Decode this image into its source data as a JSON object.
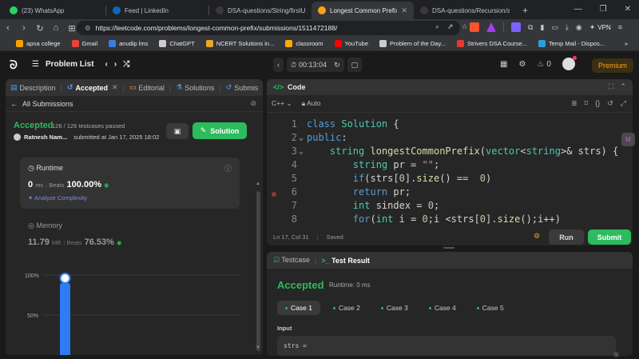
{
  "browser": {
    "tabs": [
      {
        "label": "(23) WhatsApp",
        "icon": "whatsapp-icon",
        "color": "#25d366"
      },
      {
        "label": "Feed | LinkedIn",
        "icon": "linkedin-icon",
        "color": "#0a66c2"
      },
      {
        "label": "DSA-questions/String/firstUniqC",
        "icon": "github-icon",
        "color": "#ffffff"
      },
      {
        "label": "Longest Common Prefix - Le",
        "icon": "leetcode-icon",
        "color": "#ffa116",
        "active": true
      },
      {
        "label": "DSA-questions/Recursion/subse",
        "icon": "github-icon",
        "color": "#ffffff"
      }
    ],
    "new_tab": "+",
    "url": "https://leetcode.com/problems/longest-common-prefix/submissions/1511472188/",
    "vpn_label": "VPN",
    "bookmarks": [
      {
        "label": "apna college",
        "color": "#f4a300"
      },
      {
        "label": "Gmail",
        "color": "#ea4335"
      },
      {
        "label": "anudip lms",
        "color": "#3b7ddd"
      },
      {
        "label": "ChatGPT",
        "color": "#cccccc"
      },
      {
        "label": "NCERT Solutions in...",
        "color": "#e9a72c"
      },
      {
        "label": "classroom",
        "color": "#f9ab00"
      },
      {
        "label": "YouTube",
        "color": "#ff0000"
      },
      {
        "label": "Problem of the Day...",
        "color": "#cccccc"
      },
      {
        "label": "Strivers DSA Course...",
        "color": "#e33b2e"
      },
      {
        "label": "Temp Mail - Dispos...",
        "color": "#2d9fd8"
      }
    ],
    "bookmarks_more": "»"
  },
  "lc": {
    "problem_list": "Problem List",
    "timer": "00:13:04",
    "coins": "0",
    "premium": "Premium"
  },
  "left": {
    "tabs": [
      "Description",
      "Accepted",
      "Editorial",
      "Solutions",
      "Submis"
    ],
    "all_submissions": "All Submissions",
    "status": "Accepted",
    "testcases": "126 / 126 testcases passed",
    "author": "Ratnesh Nam...",
    "submitted": "submitted at Jan 17, 2025 18:02",
    "solution_btn": "Solution",
    "runtime": {
      "title": "Runtime",
      "value": "0",
      "unit": "ms",
      "beats_label": "Beats",
      "beats": "100.00%",
      "analyze": "Analyze Complexity"
    },
    "memory": {
      "title": "Memory",
      "value": "11.79",
      "unit": "MB",
      "beats_label": "Beats",
      "beats": "76.53%"
    }
  },
  "chart_data": {
    "type": "bar",
    "y_ticks": [
      "100%",
      "50%"
    ],
    "ylim": [
      0,
      100
    ],
    "values": [
      100
    ],
    "bar_color": "#2f7bf6"
  },
  "code": {
    "title": "Code",
    "language": "C++",
    "mode": "Auto",
    "lines": [
      {
        "n": "1",
        "fold": "",
        "html": "<span class=\"kw\">class</span> <span class=\"ty\">Solution</span> {"
      },
      {
        "n": "2",
        "fold": "⌄",
        "html": "<span class=\"kw\">public</span>:"
      },
      {
        "n": "3",
        "fold": "⌄",
        "html": "    <span class=\"ty\">string</span> <span class=\"fn\">longestCommonPrefix</span>(<span class=\"ty\">vector</span>&lt;<span class=\"ty\">string</span>&gt;&amp; strs) {"
      },
      {
        "n": "4",
        "fold": "",
        "html": "        <span class=\"ty\">string</span> pr = <span class=\"st\">\"\"</span>;"
      },
      {
        "n": "5",
        "fold": "",
        "html": "        <span class=\"kw\">if</span>(strs[<span class=\"nm\">0</span>].<span class=\"fn\">size</span>() ==  <span class=\"nm\">0</span>)"
      },
      {
        "n": "6",
        "fold": "",
        "html": "        <span class=\"kw\">return</span> pr;"
      },
      {
        "n": "7",
        "fold": "",
        "html": "        <span class=\"ty\">int</span> sindex = <span class=\"nm\">0</span>;"
      },
      {
        "n": "8",
        "fold": "",
        "html": "        <span class=\"kw\">for</span>(<span class=\"ty\">int</span> i = <span class=\"nm\">0</span>;i &lt;strs[<span class=\"nm\">0</span>].<span class=\"fn\">size</span>();i++)"
      }
    ],
    "cursor": "Ln 17, Col 31",
    "saved": "Saved",
    "run": "Run",
    "submit": "Submit"
  },
  "result": {
    "tab_testcase": "Testcase",
    "tab_result": "Test Result",
    "status": "Accepted",
    "runtime": "Runtime: 0 ms",
    "cases": [
      "Case 1",
      "Case 2",
      "Case 3",
      "Case 4",
      "Case 5"
    ],
    "input_label": "Input",
    "input_value": "strs ="
  }
}
